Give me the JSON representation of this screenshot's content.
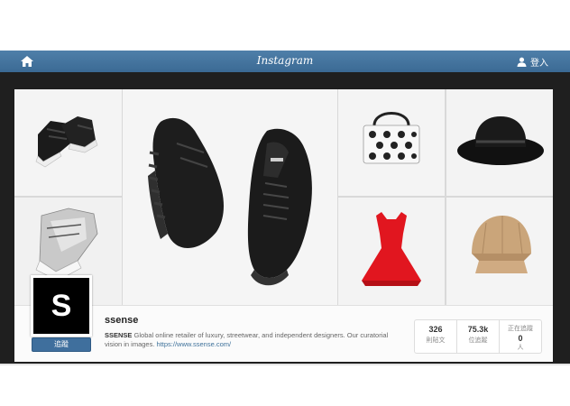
{
  "header": {
    "brand": "Instagram",
    "login_label": "登入",
    "icons": {
      "home": "home-icon",
      "user": "user-icon"
    },
    "bar_color": "#3f6f9d"
  },
  "gallery": {
    "images": [
      {
        "subject": "black-high-top-sneakers",
        "icon": "sneaker-image"
      },
      {
        "subject": "silver-high-top-sneakers",
        "icon": "sneaker-image"
      },
      {
        "subject": "black-running-sneakers",
        "icon": "sneaker-image"
      },
      {
        "subject": "polka-dot-handbag",
        "icon": "handbag-image"
      },
      {
        "subject": "red-dress",
        "icon": "dress-image"
      },
      {
        "subject": "black-fedora-hat",
        "icon": "hat-image"
      },
      {
        "subject": "tan-cap",
        "icon": "cap-image"
      }
    ]
  },
  "profile": {
    "avatar_letter": "S",
    "follow_label": "追蹤",
    "username": "ssense",
    "bio_name": "SSENSE",
    "bio_text": " Global online retailer of luxury, streetwear, and independent designers. Our curatorial vision in images.",
    "bio_link": "https://www.ssense.com/",
    "stats": [
      {
        "value": "326",
        "label": "則貼文"
      },
      {
        "value": "75.3k",
        "label": "位追蹤"
      },
      {
        "value": "0",
        "label": "人",
        "top_label": "正在追蹤"
      }
    ]
  }
}
